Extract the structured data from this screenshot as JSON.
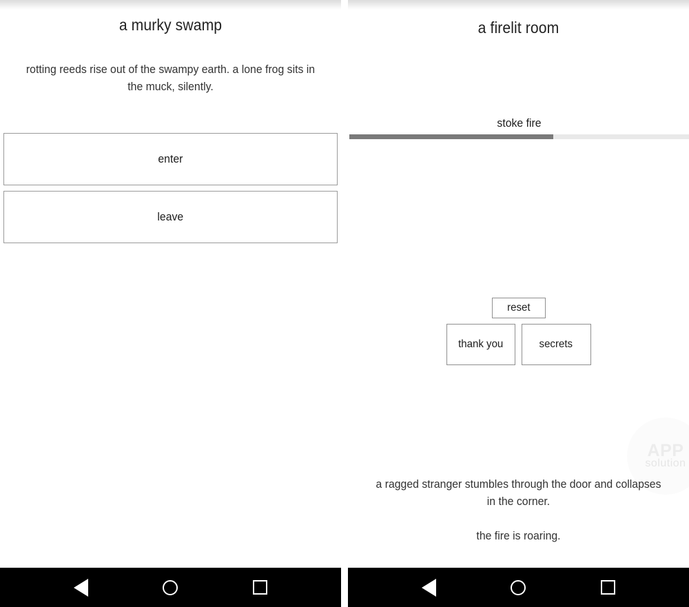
{
  "left_panel": {
    "title": "a murky swamp",
    "story": "rotting reeds rise out of the swampy earth. a lone frog sits in the muck, silently.",
    "buttons": [
      {
        "label": "enter"
      },
      {
        "label": "leave"
      }
    ]
  },
  "right_panel": {
    "title": "a firelit room",
    "stoke": {
      "label": "stoke fire",
      "progress_percent": 60
    },
    "footer_buttons": {
      "reset": "reset",
      "thank_you": "thank you",
      "secrets": "secrets"
    },
    "event_log": [
      "a ragged stranger stumbles through the door and collapses in the corner.",
      "the fire is roaring."
    ],
    "watermark": {
      "main": "APP",
      "sub": "solution"
    }
  },
  "navbar": {
    "back": "back-icon",
    "home": "home-icon",
    "recents": "recents-icon"
  },
  "colors": {
    "text": "#222222",
    "button_border": "#9a9a9a",
    "progress_fill": "#7a7a7a",
    "progress_track": "#e9e9e9",
    "navbar_bg": "#000000"
  }
}
